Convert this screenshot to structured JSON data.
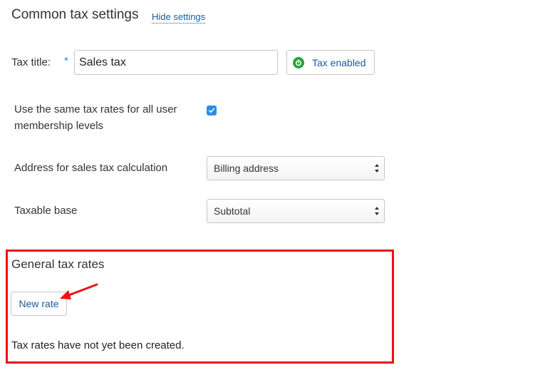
{
  "settings": {
    "title": "Common tax settings",
    "hide_link": "Hide settings"
  },
  "tax_title": {
    "label": "Tax title:",
    "required_marker": "*",
    "value": "Sales tax"
  },
  "tax_enabled": {
    "label": "Tax enabled",
    "icon": "power-icon",
    "color": "#1fa83a"
  },
  "same_rates": {
    "label": "Use the same tax rates for all user membership levels",
    "checked": true
  },
  "address": {
    "label": "Address for sales tax calculation",
    "selected": "Billing address"
  },
  "taxable_base": {
    "label": "Taxable base",
    "selected": "Subtotal"
  },
  "general_rates": {
    "title": "General tax rates",
    "new_rate_label": "New rate",
    "empty_message": "Tax rates have not yet been created.",
    "highlight_color": "#ee1111"
  },
  "colors": {
    "link": "#1a5a9c",
    "checkbox": "#2a8ee8"
  }
}
